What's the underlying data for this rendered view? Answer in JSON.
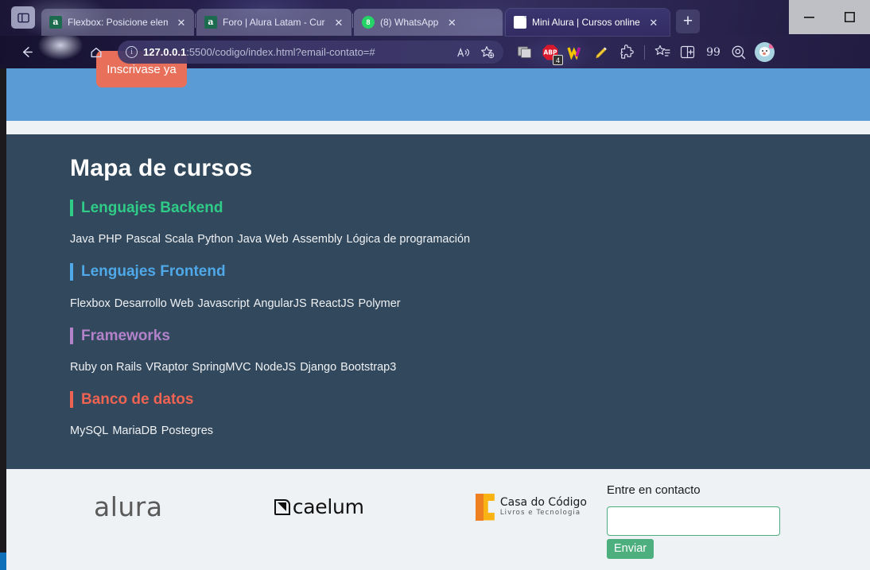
{
  "browser": {
    "tab_actions_icon": "tab-actions-icon",
    "tabs": [
      {
        "title": "Flexbox: Posicione elemento",
        "favicon": "alura-favicon",
        "active": false,
        "close_label": "✕"
      },
      {
        "title": "Foro | Alura Latam - Cursos c",
        "favicon": "alura-favicon",
        "active": false,
        "close_label": "✕"
      },
      {
        "title": "(8) WhatsApp",
        "favicon": "whatsapp-favicon",
        "badge": "8",
        "active": false,
        "close_label": "✕"
      },
      {
        "title": "Mini Alura | Cursos online",
        "favicon": "document-favicon",
        "active": true,
        "close_label": "✕"
      }
    ],
    "new_tab_label": "+",
    "window_controls": {
      "minimize": "—",
      "maximize": "❑"
    },
    "nav": {
      "back": "back-arrow",
      "profile_pic": "profile-glyph",
      "home": "home-icon"
    },
    "url_host": "127.0.0.1",
    "url_path": ":5500/codigo/index.html?email-contato=#",
    "omnibox_buttons": [
      "read-aloud-icon",
      "add-favorite-icon"
    ],
    "extensions": [
      {
        "name": "image-stack-icon",
        "badge": ""
      },
      {
        "name": "adblock-plus-icon",
        "label": "ABP",
        "badge": "4"
      },
      {
        "name": "wappalyzer-icon",
        "label": "W"
      },
      {
        "name": "highlighter-pen-icon"
      },
      {
        "name": "extensions-puzzle-icon"
      }
    ],
    "tray": [
      {
        "name": "collections-icon"
      },
      {
        "name": "split-screen-icon"
      },
      {
        "name": "quotes-icon",
        "label": "99"
      },
      {
        "name": "screenshot-icon"
      },
      {
        "name": "profile-avatar"
      }
    ]
  },
  "page": {
    "banner": {
      "cta_label": "Inscrivase ya"
    },
    "coursemap": {
      "title": "Mapa de cursos",
      "categories": [
        {
          "name": "Lenguajes Backend",
          "color": "#2ecc87",
          "courses": [
            "Java",
            "PHP",
            "Pascal",
            "Scala",
            "Python",
            "Java Web",
            "Assembly",
            "Lógica de programación"
          ]
        },
        {
          "name": "Lenguajes Frontend",
          "color": "#4fa8e8",
          "courses": [
            "Flexbox",
            "Desarrollo Web",
            "Javascript",
            "AngularJS",
            "ReactJS",
            "Polymer"
          ]
        },
        {
          "name": "Frameworks",
          "color": "#b282cb",
          "courses": [
            "Ruby on Rails",
            "VRaptor",
            "SpringMVC",
            "NodeJS",
            "Django",
            "Bootstrap3"
          ]
        },
        {
          "name": "Banco de datos",
          "color": "#ee6352",
          "courses": [
            "MySQL",
            "MariaDB",
            "Postegres"
          ]
        }
      ]
    },
    "footer": {
      "logos": [
        {
          "name": "alura-logo",
          "text": "alura"
        },
        {
          "name": "caelum-logo",
          "text": "caelum"
        },
        {
          "name": "casa-do-codigo-logo",
          "text": "Casa do Código",
          "tagline": "Livros e Tecnologia"
        }
      ],
      "contact": {
        "label": "Entre en contacto",
        "input_value": "",
        "input_placeholder": "",
        "submit_label": "Enviar"
      }
    }
  }
}
